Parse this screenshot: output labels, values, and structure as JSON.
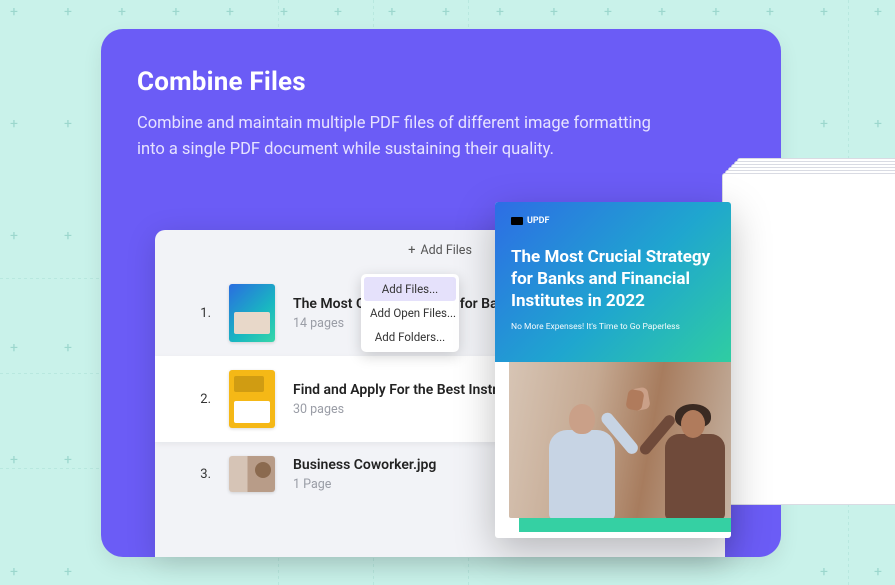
{
  "header": {
    "title": "Combine Files",
    "description": "Combine and maintain multiple PDF files of different image formatting into a single PDF document while sustaining their quality."
  },
  "toolbar": {
    "add_files_label": "Add Files",
    "plus_icon": "+"
  },
  "menu": {
    "items": [
      {
        "label": "Add Files..."
      },
      {
        "label": "Add Open Files..."
      },
      {
        "label": "Add Folders..."
      }
    ]
  },
  "files": [
    {
      "index": "1.",
      "name": "The Most Crucial Strategy for Banks",
      "pages": "14 pages"
    },
    {
      "index": "2.",
      "name": "Find and Apply For the Best Instruments",
      "pages": "30 pages"
    },
    {
      "index": "3.",
      "name": "Business Coworker.jpg",
      "pages": "1 Page"
    }
  ],
  "preview": {
    "logo_text": "UPDF",
    "title": "The Most Crucial Strategy for Banks and Financial Institutes in 2022",
    "subtitle": "No More Expenses! It's Time to Go Paperless"
  }
}
